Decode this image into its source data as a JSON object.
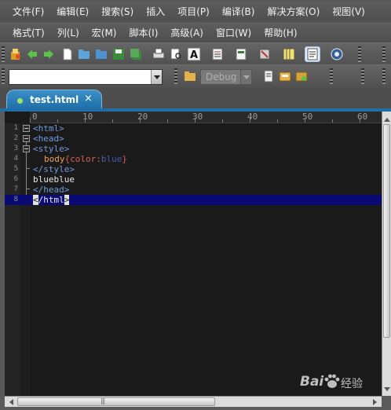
{
  "menu_row1": [
    "文件(F)",
    "编辑(E)",
    "搜索(S)",
    "插入",
    "项目(P)",
    "编译(B)",
    "解决方案(O)",
    "视图(V)"
  ],
  "menu_row2": [
    "格式(T)",
    "列(L)",
    "宏(M)",
    "脚本(I)",
    "高级(A)",
    "窗口(W)",
    "帮助(H)"
  ],
  "toolbar": {
    "address_value": "",
    "build_config": "Debug"
  },
  "tab": {
    "label": "test.html",
    "close": "×"
  },
  "ruler": {
    "marks": [
      "0",
      "10",
      "20",
      "30",
      "40",
      "50",
      "60"
    ]
  },
  "editor": {
    "line_numbers": [
      "1",
      "2",
      "3",
      "4",
      "5",
      "6",
      "7",
      "8"
    ],
    "lines": {
      "l1": "<html>",
      "l2": "<head>",
      "l3": "<style>",
      "l4_sel": "body",
      "l4_open": "{",
      "l4_prop": "color:",
      "l4_val": "blue",
      "l4_close": "}",
      "l5": "</style>",
      "l6": "blueblue",
      "l7": "</head>",
      "l8_open": "<",
      "l8_mid": "/html",
      "l8_close": ">"
    }
  },
  "scrollbar": {
    "hgrip": "|||"
  },
  "watermark": {
    "brand": "Bai",
    "brand2": "经验"
  },
  "colors": {
    "tab_active": "#1f6ea8",
    "current_line": "#0a0a75",
    "tag": "#6f9be0"
  }
}
